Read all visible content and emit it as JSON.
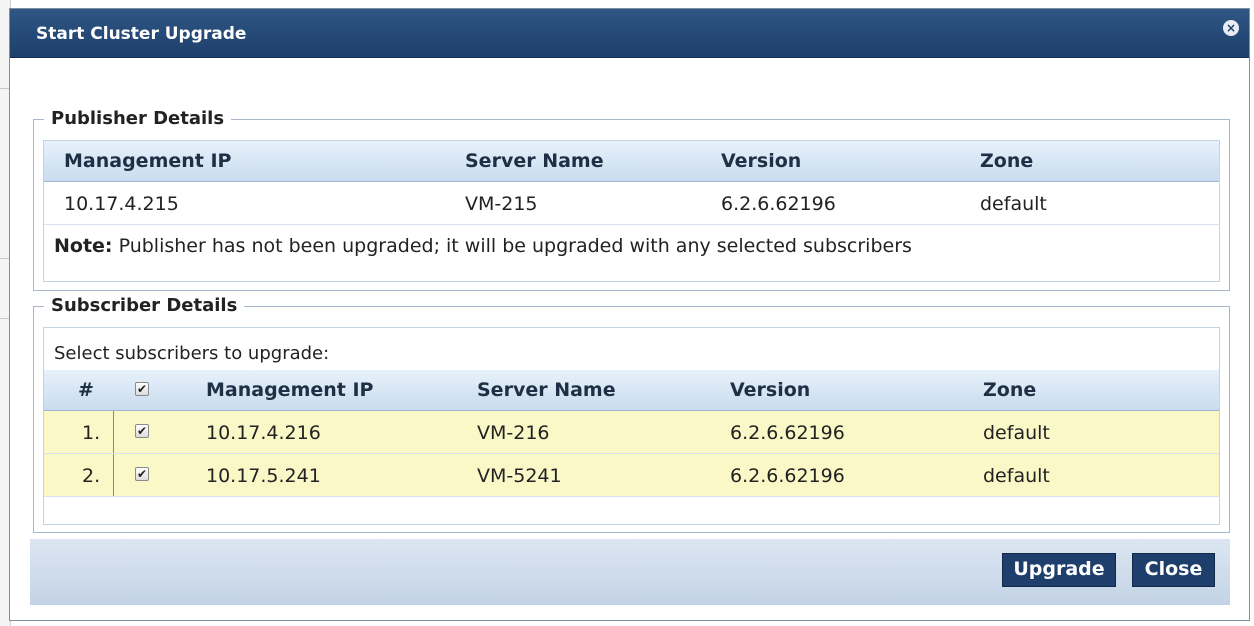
{
  "dialog": {
    "title": "Start Cluster Upgrade",
    "close_symbol": "×"
  },
  "publisher": {
    "legend": "Publisher Details",
    "columns": [
      "Management IP",
      "Server Name",
      "Version",
      "Zone"
    ],
    "row": {
      "ip": "10.17.4.215",
      "name": "VM-215",
      "version": "6.2.6.62196",
      "zone": "default"
    },
    "note_label": "Note:",
    "note_text": " Publisher has not been upgraded; it will be upgraded with any selected subscribers"
  },
  "subscriber": {
    "legend": "Subscriber Details",
    "caption": "Select subscribers to upgrade:",
    "columns": {
      "num": "#",
      "ip": "Management IP",
      "name": "Server Name",
      "version": "Version",
      "zone": "Zone"
    },
    "select_all_checked": true,
    "rows": [
      {
        "num": "1.",
        "checked": true,
        "ip": "10.17.4.216",
        "name": "VM-216",
        "version": "6.2.6.62196",
        "zone": "default"
      },
      {
        "num": "2.",
        "checked": true,
        "ip": "10.17.5.241",
        "name": "VM-5241",
        "version": "6.2.6.62196",
        "zone": "default"
      }
    ]
  },
  "buttons": {
    "upgrade": "Upgrade",
    "close": "Close"
  },
  "check_symbol": "✔",
  "colors": {
    "titlebar": "#1d3f6b",
    "selected_row": "#fbf8c8",
    "button": "#1e3f6c"
  }
}
